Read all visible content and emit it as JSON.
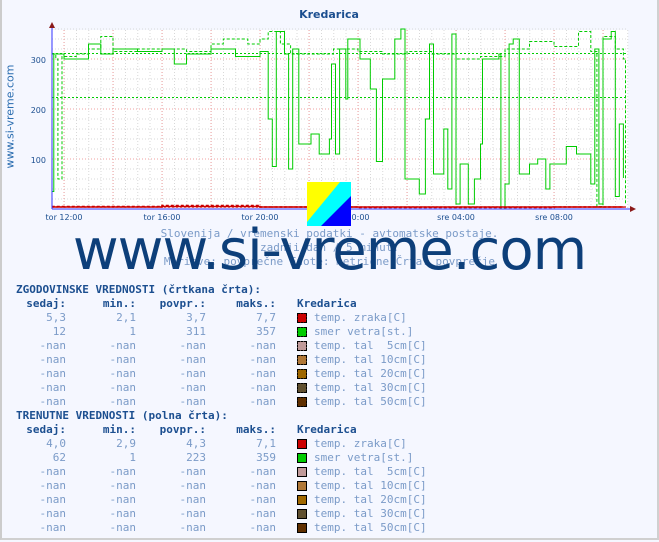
{
  "chart_data": {
    "type": "line",
    "title": "Kredarica",
    "ylim": [
      0,
      360
    ],
    "yticks": [
      100,
      200,
      300
    ],
    "xticks": [
      "tor 12:00",
      "tor 16:00",
      "tor 20:00",
      "00:00",
      "sre 04:00",
      "sre 08:00"
    ],
    "grid": true,
    "subtitle_lines": [
      "Slovenija / vremenski podatki - avtomatske postaje.",
      "zadnji dan / 5 minut.",
      "Meritve: povprečne  Enote: metrične  Črta: povprečje"
    ],
    "series": [
      {
        "name": "smer vetra[st.]",
        "style": "solid",
        "color": "#00cc00",
        "avg": 223,
        "points": [
          [
            "11:30",
            35
          ],
          [
            "11:35",
            310
          ],
          [
            "12:00",
            300
          ],
          [
            "12:30",
            300
          ],
          [
            "13:00",
            330
          ],
          [
            "13:30",
            310
          ],
          [
            "14:00",
            320
          ],
          [
            "15:00",
            315
          ],
          [
            "16:00",
            320
          ],
          [
            "16:30",
            290
          ],
          [
            "17:00",
            310
          ],
          [
            "18:00",
            320
          ],
          [
            "19:00",
            305
          ],
          [
            "20:00",
            315
          ],
          [
            "20:20",
            180
          ],
          [
            "20:30",
            85
          ],
          [
            "20:40",
            355
          ],
          [
            "21:00",
            310
          ],
          [
            "21:10",
            80
          ],
          [
            "21:20",
            320
          ],
          [
            "21:35",
            130
          ],
          [
            "22:05",
            150
          ],
          [
            "22:25",
            110
          ],
          [
            "22:50",
            140
          ],
          [
            "22:55",
            290
          ],
          [
            "23:05",
            110
          ],
          [
            "23:15",
            320
          ],
          [
            "23:30",
            220
          ],
          [
            "23:35",
            340
          ],
          [
            "00:05",
            300
          ],
          [
            "00:30",
            240
          ],
          [
            "00:45",
            95
          ],
          [
            "01:00",
            260
          ],
          [
            "01:20",
            260
          ],
          [
            "01:30",
            340
          ],
          [
            "01:45",
            360
          ],
          [
            "01:55",
            60
          ],
          [
            "02:30",
            30
          ],
          [
            "02:45",
            180
          ],
          [
            "02:55",
            330
          ],
          [
            "03:05",
            70
          ],
          [
            "03:30",
            160
          ],
          [
            "03:40",
            40
          ],
          [
            "03:50",
            350
          ],
          [
            "04:00",
            10
          ],
          [
            "04:10",
            90
          ],
          [
            "04:30",
            10
          ],
          [
            "04:45",
            60
          ],
          [
            "05:00",
            130
          ],
          [
            "05:05",
            300
          ],
          [
            "05:45",
            310
          ],
          [
            "05:50",
            0
          ],
          [
            "06:00",
            50
          ],
          [
            "06:10",
            330
          ],
          [
            "06:20",
            340
          ],
          [
            "06:35",
            70
          ],
          [
            "07:00",
            90
          ],
          [
            "07:20",
            100
          ],
          [
            "07:40",
            40
          ],
          [
            "07:50",
            90
          ],
          [
            "08:20",
            90
          ],
          [
            "08:30",
            125
          ],
          [
            "08:55",
            110
          ],
          [
            "09:30",
            50
          ],
          [
            "09:40",
            320
          ],
          [
            "09:50",
            10
          ],
          [
            "10:00",
            340
          ],
          [
            "10:20",
            355
          ],
          [
            "10:30",
            25
          ],
          [
            "10:40",
            170
          ],
          [
            "10:50",
            62
          ]
        ]
      },
      {
        "name": "smer vetra[st.] (zgodovinske)",
        "style": "dashed",
        "color": "#00cc00",
        "avg": 311,
        "points": [
          [
            "11:30",
            310
          ],
          [
            "11:40",
            300
          ],
          [
            "11:45",
            60
          ],
          [
            "11:55",
            305
          ],
          [
            "12:30",
            310
          ],
          [
            "13:00",
            320
          ],
          [
            "13:30",
            345
          ],
          [
            "14:00",
            315
          ],
          [
            "15:00",
            320
          ],
          [
            "16:00",
            320
          ],
          [
            "17:00",
            315
          ],
          [
            "18:00",
            330
          ],
          [
            "18:30",
            340
          ],
          [
            "19:30",
            330
          ],
          [
            "20:00",
            340
          ],
          [
            "20:20",
            355
          ],
          [
            "20:50",
            330
          ],
          [
            "21:15",
            310
          ],
          [
            "22:00",
            310
          ],
          [
            "23:00",
            320
          ],
          [
            "00:00",
            315
          ],
          [
            "01:00",
            310
          ],
          [
            "02:00",
            315
          ],
          [
            "03:00",
            310
          ],
          [
            "04:00",
            300
          ],
          [
            "05:00",
            305
          ],
          [
            "06:00",
            320
          ],
          [
            "07:00",
            335
          ],
          [
            "08:00",
            325
          ],
          [
            "09:00",
            355
          ],
          [
            "09:30",
            315
          ],
          [
            "09:45",
            5
          ],
          [
            "10:00",
            345
          ],
          [
            "10:30",
            320
          ],
          [
            "10:50",
            300
          ],
          [
            "10:55",
            10
          ]
        ]
      },
      {
        "name": "temp. zraka[C]",
        "style": "solid",
        "color": "#cc0000",
        "avg": 4.3,
        "points": [
          [
            "11:30",
            4
          ],
          [
            "16:00",
            5
          ],
          [
            "20:00",
            4
          ],
          [
            "00:00",
            4
          ],
          [
            "04:00",
            4
          ],
          [
            "08:00",
            4
          ],
          [
            "10:50",
            4
          ]
        ]
      },
      {
        "name": "temp. zraka[C] (zgodovinske)",
        "style": "dashed",
        "color": "#cc0000",
        "avg": 3.7,
        "points": [
          [
            "11:30",
            5
          ],
          [
            "16:00",
            7
          ],
          [
            "20:00",
            4
          ],
          [
            "00:00",
            3
          ],
          [
            "04:00",
            3
          ],
          [
            "08:00",
            4
          ],
          [
            "10:50",
            5
          ]
        ]
      }
    ]
  },
  "side_label": "www.si-vreme.com",
  "watermark": "www.si-vreme.com",
  "hist": {
    "title": "ZGODOVINSKE VREDNOSTI (črtkana črta):",
    "headers": [
      "sedaj:",
      "min.:",
      "povpr.:",
      "maks.:",
      "Kredarica"
    ],
    "rows": [
      {
        "v": [
          "5,3",
          "2,1",
          "3,7",
          "7,7"
        ],
        "label": "temp. zraka[C]",
        "color": "#cc0000"
      },
      {
        "v": [
          "12",
          "1",
          "311",
          "357"
        ],
        "label": "smer vetra[st.]",
        "color": "#00cc00"
      },
      {
        "v": [
          "-nan",
          "-nan",
          "-nan",
          "-nan"
        ],
        "label": "temp. tal  5cm[C]",
        "color": "#c09a9a"
      },
      {
        "v": [
          "-nan",
          "-nan",
          "-nan",
          "-nan"
        ],
        "label": "temp. tal 10cm[C]",
        "color": "#b07838"
      },
      {
        "v": [
          "-nan",
          "-nan",
          "-nan",
          "-nan"
        ],
        "label": "temp. tal 20cm[C]",
        "color": "#a06800"
      },
      {
        "v": [
          "-nan",
          "-nan",
          "-nan",
          "-nan"
        ],
        "label": "temp. tal 30cm[C]",
        "color": "#605030"
      },
      {
        "v": [
          "-nan",
          "-nan",
          "-nan",
          "-nan"
        ],
        "label": "temp. tal 50cm[C]",
        "color": "#603000"
      }
    ]
  },
  "curr": {
    "title": "TRENUTNE VREDNOSTI (polna črta):",
    "headers": [
      "sedaj:",
      "min.:",
      "povpr.:",
      "maks.:",
      "Kredarica"
    ],
    "rows": [
      {
        "v": [
          "4,0",
          "2,9",
          "4,3",
          "7,1"
        ],
        "label": "temp. zraka[C]",
        "color": "#cc0000"
      },
      {
        "v": [
          "62",
          "1",
          "223",
          "359"
        ],
        "label": "smer vetra[st.]",
        "color": "#00cc00"
      },
      {
        "v": [
          "-nan",
          "-nan",
          "-nan",
          "-nan"
        ],
        "label": "temp. tal  5cm[C]",
        "color": "#c09a9a"
      },
      {
        "v": [
          "-nan",
          "-nan",
          "-nan",
          "-nan"
        ],
        "label": "temp. tal 10cm[C]",
        "color": "#b07838"
      },
      {
        "v": [
          "-nan",
          "-nan",
          "-nan",
          "-nan"
        ],
        "label": "temp. tal 20cm[C]",
        "color": "#a06800"
      },
      {
        "v": [
          "-nan",
          "-nan",
          "-nan",
          "-nan"
        ],
        "label": "temp. tal 30cm[C]",
        "color": "#605030"
      },
      {
        "v": [
          "-nan",
          "-nan",
          "-nan",
          "-nan"
        ],
        "label": "temp. tal 50cm[C]",
        "color": "#603000"
      }
    ]
  }
}
